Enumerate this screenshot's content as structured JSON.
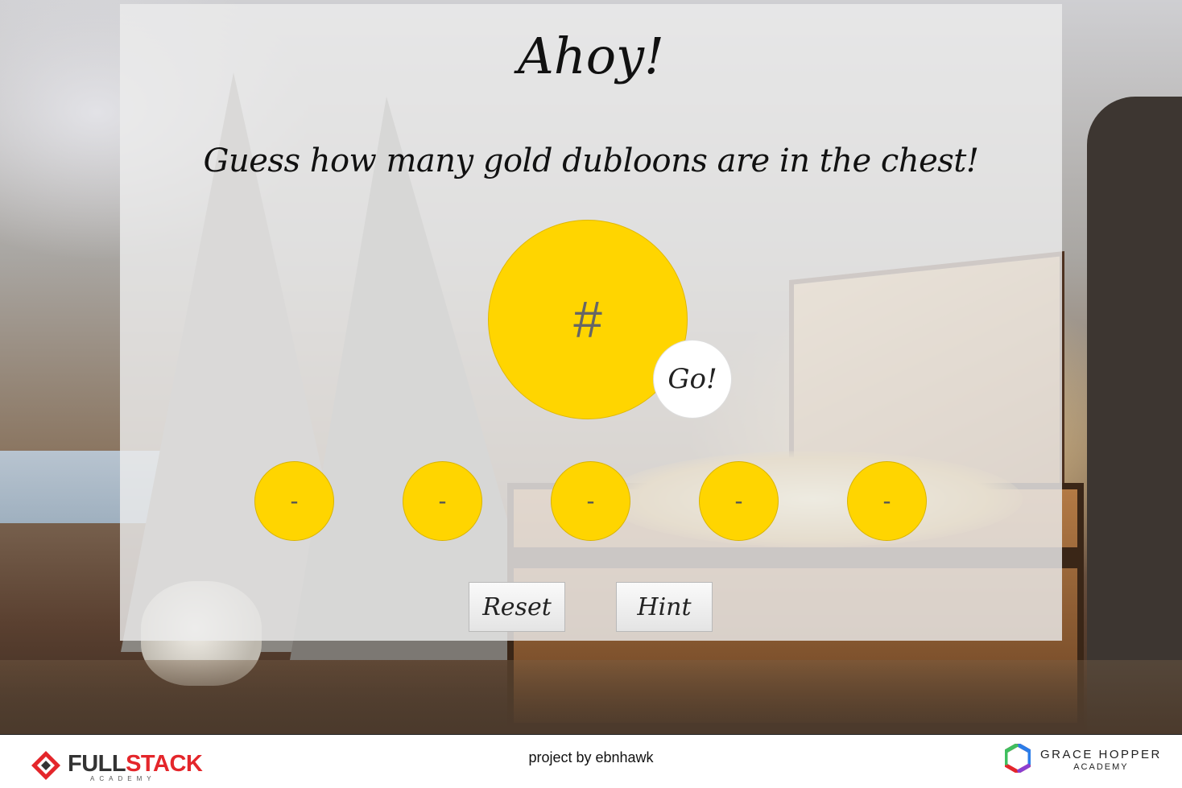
{
  "page": {
    "title": "Ahoy!",
    "subtitle": "Guess how many gold dubloons are in the chest!"
  },
  "guess": {
    "placeholder": "#",
    "go_label": "Go!"
  },
  "previous_guesses": [
    "-",
    "-",
    "-",
    "-",
    "-"
  ],
  "controls": {
    "reset_label": "Reset",
    "hint_label": "Hint"
  },
  "footer": {
    "credit": "project by ebnhawk",
    "left_logo": {
      "name_part1": "FULL",
      "name_part2": "STACK",
      "sub": "ACADEMY",
      "icon": "fullstack-logo-icon"
    },
    "right_logo": {
      "name": "GRACE HOPPER",
      "sub": "ACADEMY",
      "icon": "grace-hopper-logo-icon"
    }
  },
  "colors": {
    "coin_yellow": "#ffd500",
    "panel_overlay": "rgba(235,235,235,0.82)",
    "brand_red": "#e4262b"
  }
}
